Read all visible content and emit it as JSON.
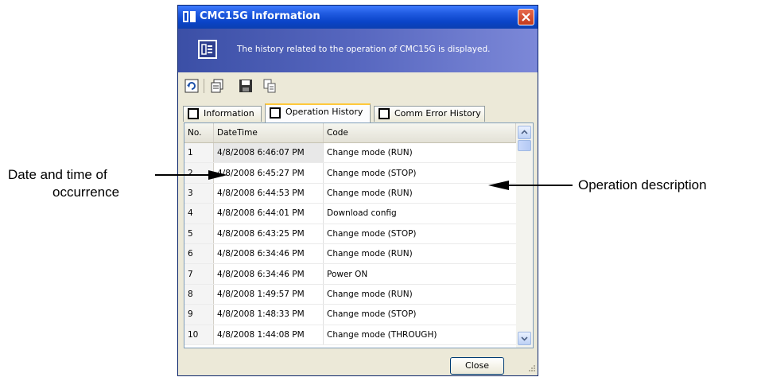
{
  "window": {
    "title": "CMC15G Information",
    "banner_text": "The history related to the operation of CMC15G is displayed."
  },
  "toolbar": {
    "buttons": [
      "refresh-icon",
      "copy-page-icon",
      "save-icon",
      "copy-icon"
    ]
  },
  "tabs": [
    {
      "label": "Information",
      "active": false
    },
    {
      "label": "Operation History",
      "active": true
    },
    {
      "label": "Comm Error History",
      "active": false
    }
  ],
  "table": {
    "headers": [
      "No.",
      "DateTime",
      "Code"
    ],
    "rows": [
      [
        "1",
        "4/8/2008 6:46:07 PM",
        "Change mode (RUN)"
      ],
      [
        "2",
        "4/8/2008 6:45:27 PM",
        "Change mode (STOP)"
      ],
      [
        "3",
        "4/8/2008 6:44:53 PM",
        "Change mode (RUN)"
      ],
      [
        "4",
        "4/8/2008 6:44:01 PM",
        "Download config"
      ],
      [
        "5",
        "4/8/2008 6:43:25 PM",
        "Change mode (STOP)"
      ],
      [
        "6",
        "4/8/2008 6:34:46 PM",
        "Change mode (RUN)"
      ],
      [
        "7",
        "4/8/2008 6:34:46 PM",
        "Power ON"
      ],
      [
        "8",
        "4/8/2008 1:49:57 PM",
        "Change mode (RUN)"
      ],
      [
        "9",
        "4/8/2008 1:48:33 PM",
        "Change mode (STOP)"
      ],
      [
        "10",
        "4/8/2008 1:44:08 PM",
        "Change mode (THROUGH)"
      ]
    ]
  },
  "close_button_label": "Close",
  "annotations": {
    "left_line1": "Date and time of",
    "left_line2": "occurrence",
    "right": "Operation description"
  },
  "colors": {
    "titlebar": "#0a44c8",
    "banner": "#5767bf",
    "close": "#d04a2a",
    "active_tab_accent": "#ffc83c"
  }
}
